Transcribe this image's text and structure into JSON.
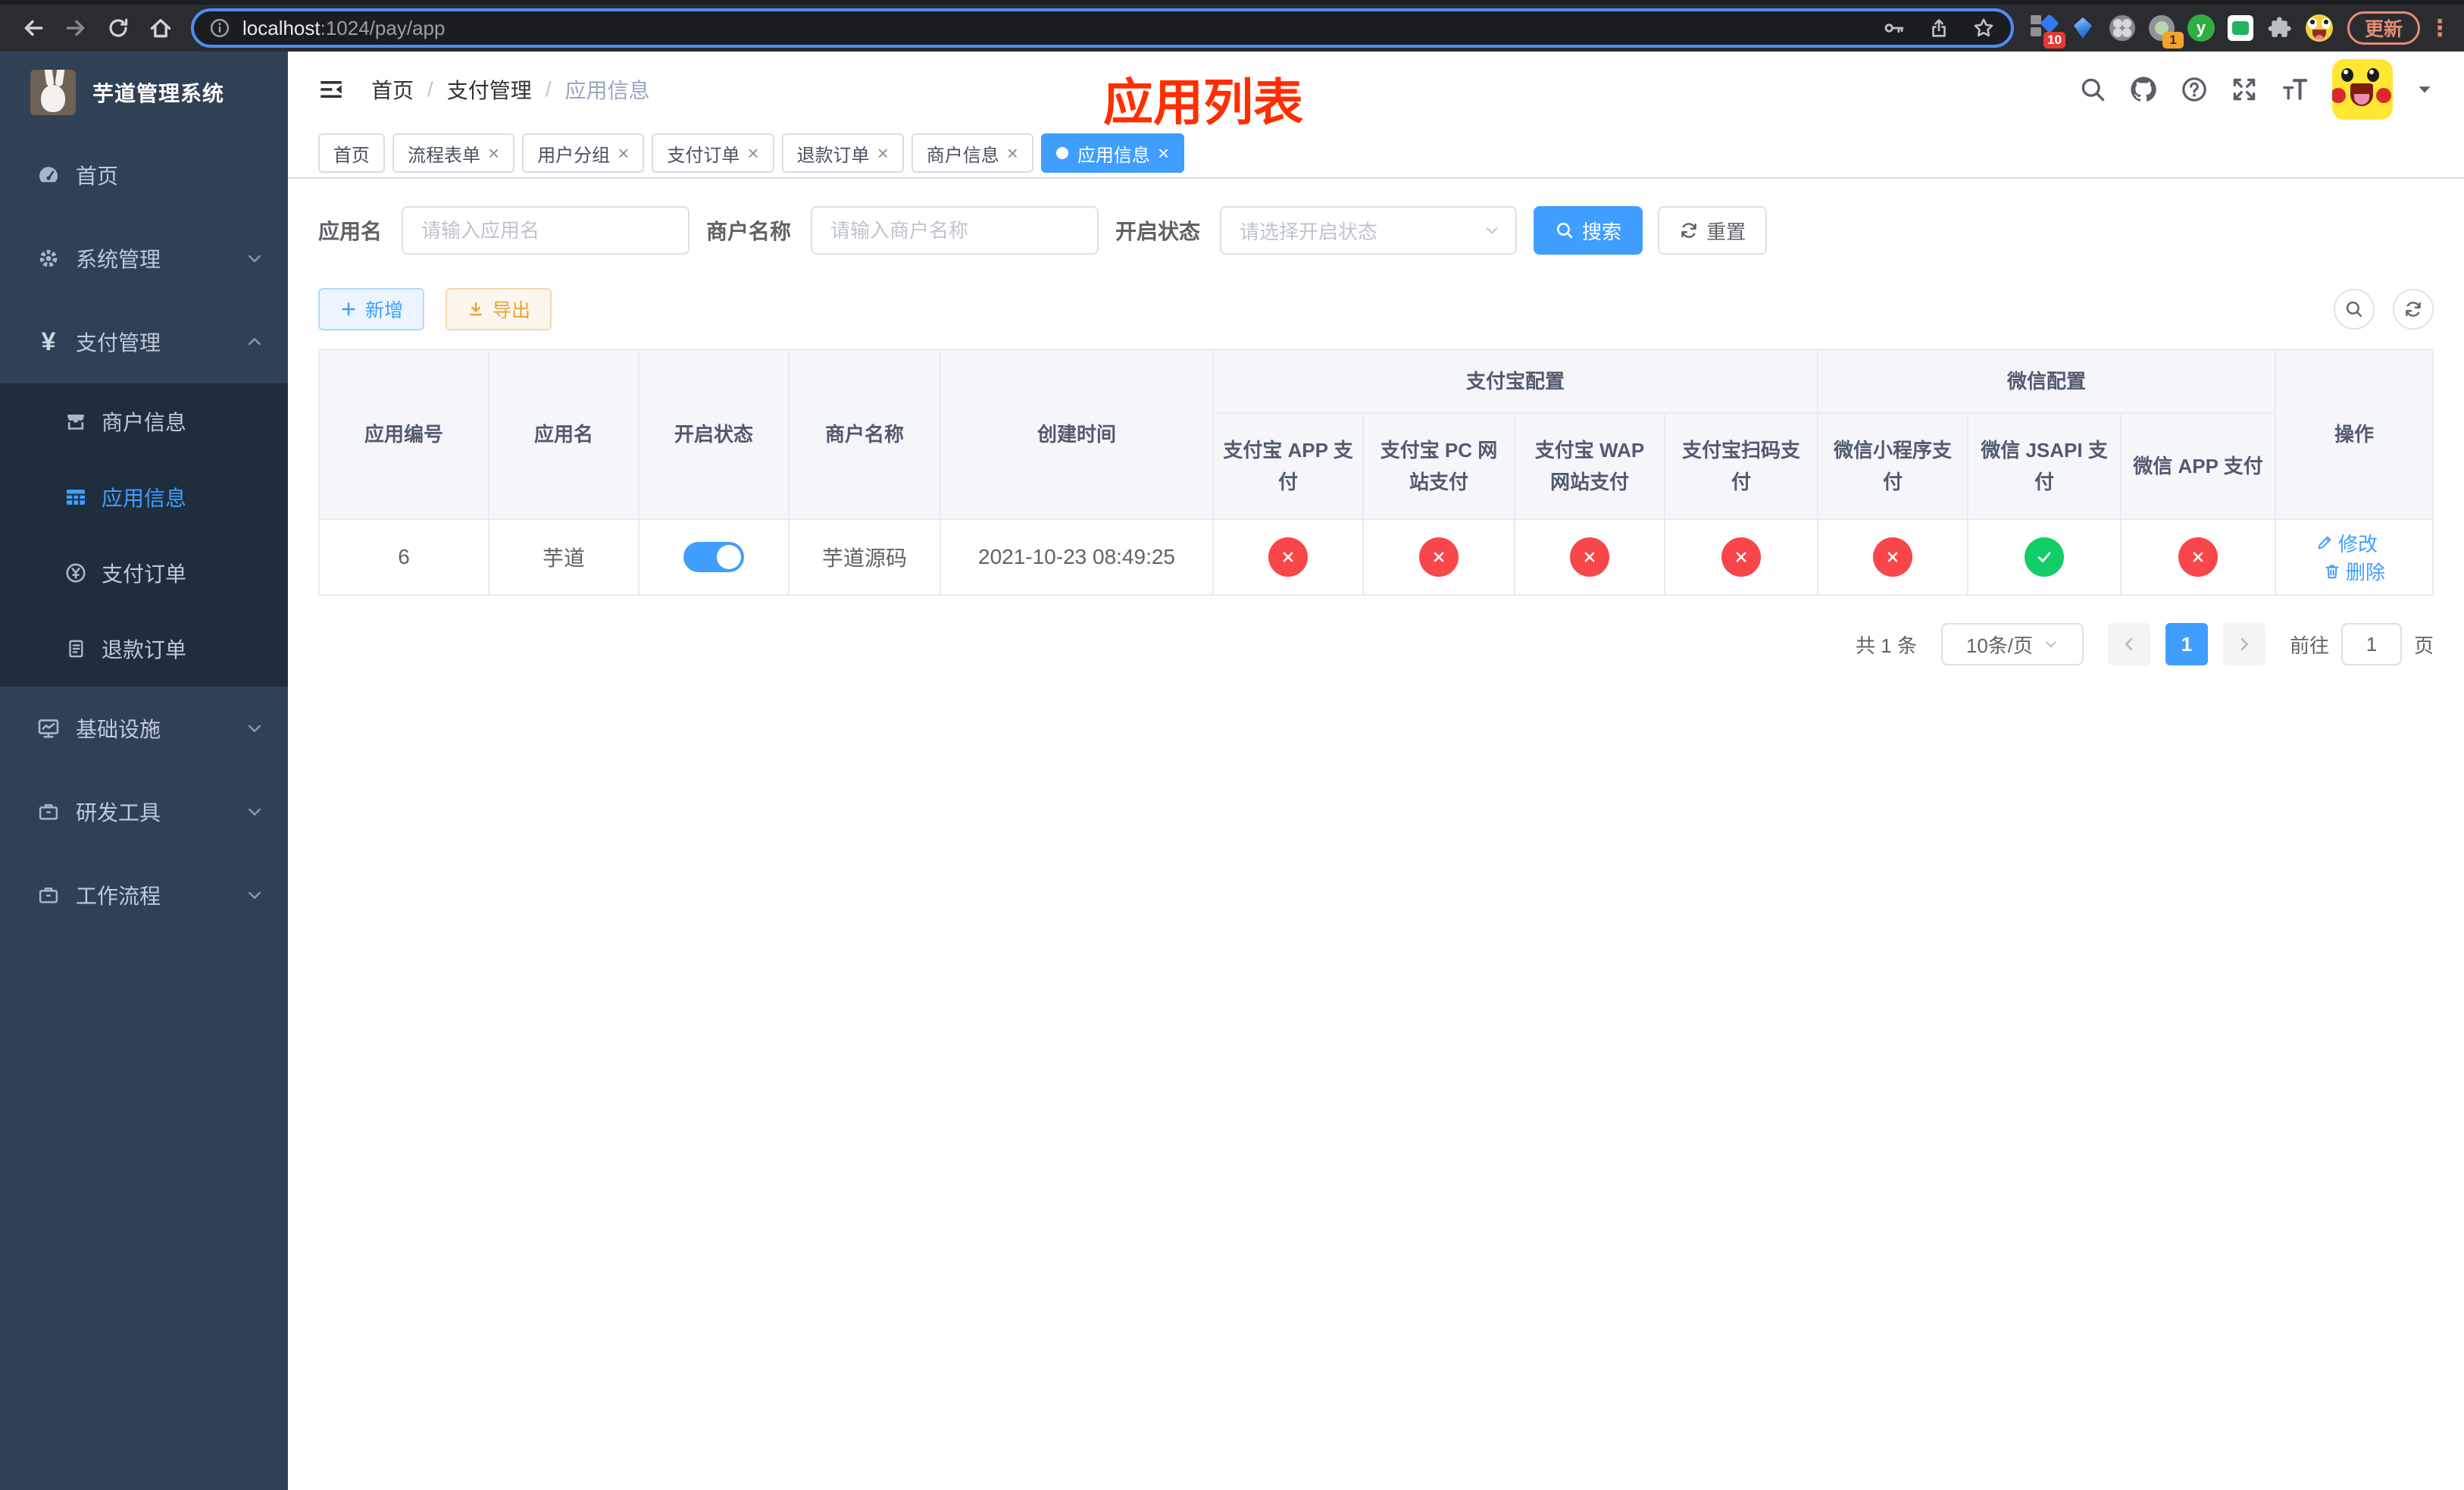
{
  "colors": {
    "accent": "#409eff",
    "danger": "#f8464b",
    "success": "#13ce66",
    "sidebar_bg": "#304156",
    "submenu_bg": "#1f2d3d",
    "overlay_red": "#ff2e00"
  },
  "browser": {
    "url": {
      "host": "localhost",
      "path": ":1024/pay/app"
    },
    "update_label": "更新",
    "ext_badges": {
      "pinned": "10",
      "proxy": "1"
    }
  },
  "sidebar": {
    "title": "芋道管理系统",
    "items": [
      {
        "label": "首页"
      },
      {
        "label": "系统管理"
      },
      {
        "label": "支付管理"
      },
      {
        "label": "基础设施"
      },
      {
        "label": "研发工具"
      },
      {
        "label": "工作流程"
      }
    ],
    "submenu": [
      {
        "label": "商户信息"
      },
      {
        "label": "应用信息",
        "active": true
      },
      {
        "label": "支付订单"
      },
      {
        "label": "退款订单"
      }
    ]
  },
  "header": {
    "breadcrumb": [
      "首页",
      "支付管理",
      "应用信息"
    ],
    "overlay_title": "应用列表"
  },
  "tabs": [
    {
      "label": "首页",
      "closable": false
    },
    {
      "label": "流程表单",
      "closable": true
    },
    {
      "label": "用户分组",
      "closable": true
    },
    {
      "label": "支付订单",
      "closable": true
    },
    {
      "label": "退款订单",
      "closable": true
    },
    {
      "label": "商户信息",
      "closable": true
    },
    {
      "label": "应用信息",
      "closable": true,
      "active": true
    }
  ],
  "filters": {
    "app_name_label": "应用名",
    "app_name_placeholder": "请输入应用名",
    "merchant_label": "商户名称",
    "merchant_placeholder": "请输入商户名称",
    "status_label": "开启状态",
    "status_placeholder": "请选择开启状态",
    "search_label": "搜索",
    "reset_label": "重置"
  },
  "toolbar": {
    "add_label": "新增",
    "export_label": "导出"
  },
  "table": {
    "columns": [
      "应用编号",
      "应用名",
      "开启状态",
      "商户名称",
      "创建时间"
    ],
    "groups": [
      {
        "label": "支付宝配置",
        "children": [
          "支付宝 APP 支付",
          "支付宝 PC 网站支付",
          "支付宝 WAP 网站支付",
          "支付宝扫码支付"
        ]
      },
      {
        "label": "微信配置",
        "children": [
          "微信小程序支付",
          "微信 JSAPI 支付",
          "微信 APP 支付"
        ]
      }
    ],
    "ops_label": "操作",
    "row": {
      "id": "6",
      "name": "芋道",
      "enabled": true,
      "merchant": "芋道源码",
      "created": "2021-10-23 08:49:25",
      "statuses": [
        false,
        false,
        false,
        false,
        false,
        true,
        false
      ],
      "edit_label": "修改",
      "delete_label": "删除"
    }
  },
  "pagination": {
    "total": "共 1 条",
    "page_size": "10条/页",
    "page": "1",
    "goto_label": "前往",
    "goto_value": "1",
    "unit_label": "页"
  }
}
